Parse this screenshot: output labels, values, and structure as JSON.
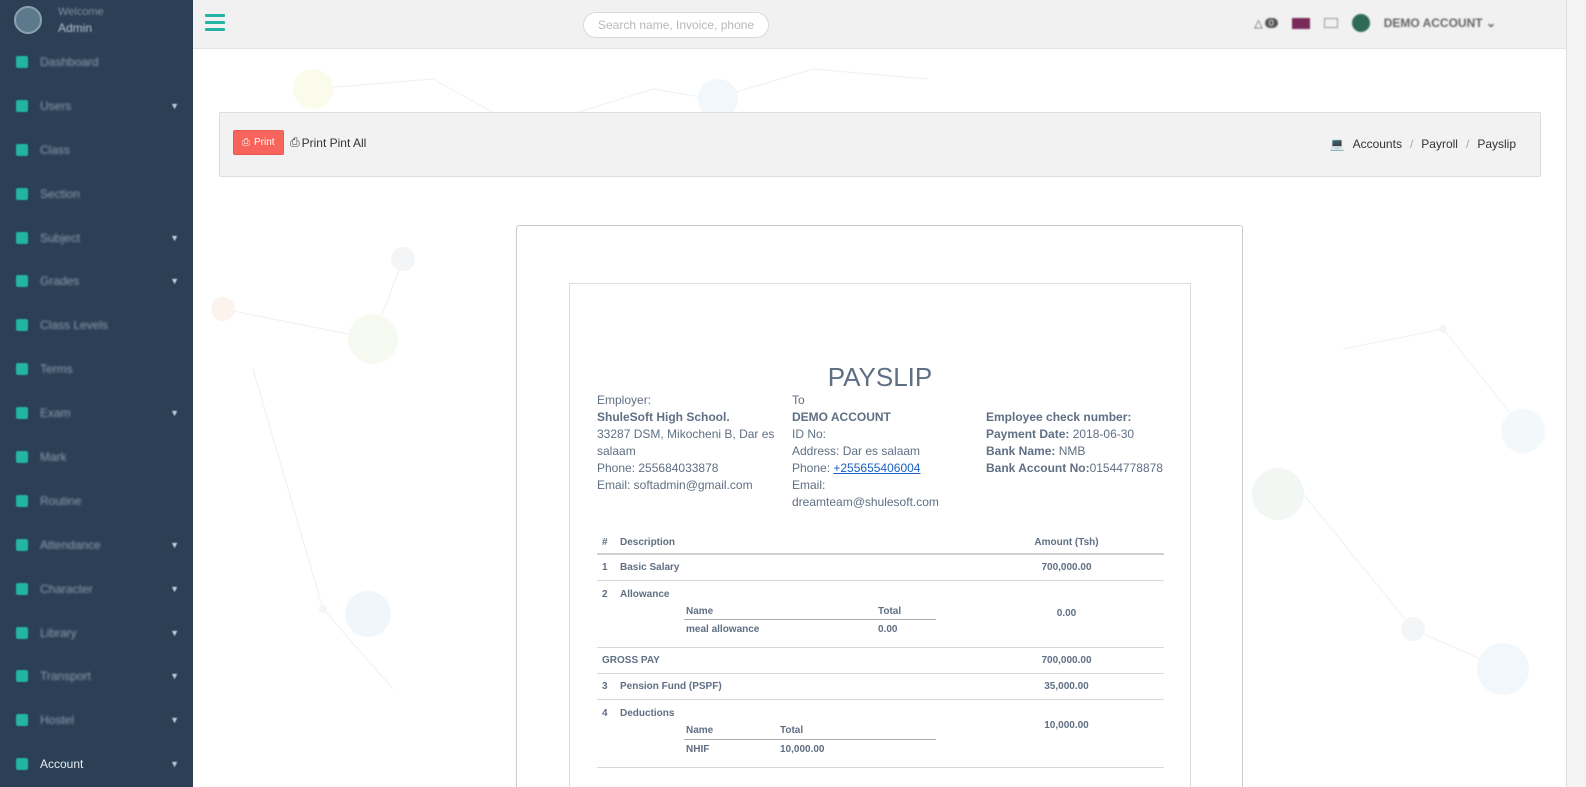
{
  "sidebar": {
    "welcome": "Welcome",
    "user": "Admin",
    "items": [
      {
        "label": "Dashboard",
        "icon": "home-icon",
        "chevron": false
      },
      {
        "label": "Users",
        "icon": "users-icon",
        "chevron": true
      },
      {
        "label": "Class",
        "icon": "sitemap-icon",
        "chevron": false
      },
      {
        "label": "Section",
        "icon": "star-icon",
        "chevron": false
      },
      {
        "label": "Subject",
        "icon": "edit-icon",
        "chevron": true
      },
      {
        "label": "Grades",
        "icon": "edit-icon",
        "chevron": true
      },
      {
        "label": "Class Levels",
        "icon": "bookmark-icon",
        "chevron": false
      },
      {
        "label": "Terms",
        "icon": "signal-icon",
        "chevron": false
      },
      {
        "label": "Exam",
        "icon": "list-icon",
        "chevron": true
      },
      {
        "label": "Mark",
        "icon": "flask-icon",
        "chevron": false
      },
      {
        "label": "Routine",
        "icon": "clock-icon",
        "chevron": false
      },
      {
        "label": "Attendance",
        "icon": "calendar-icon",
        "chevron": true
      },
      {
        "label": "Character",
        "icon": "edit-icon",
        "chevron": true
      },
      {
        "label": "Library",
        "icon": "book-icon",
        "chevron": true
      },
      {
        "label": "Transport",
        "icon": "bus-icon",
        "chevron": true
      },
      {
        "label": "Hostel",
        "icon": "bed-icon",
        "chevron": true
      },
      {
        "label": "Account",
        "icon": "wallet-icon",
        "chevron": true,
        "active": true
      }
    ]
  },
  "topbar": {
    "search_placeholder": "Search name, Invoice, phone, ref",
    "notification_count": "0",
    "account_label": "DEMO ACCOUNT"
  },
  "toolbar": {
    "print_label": "Print",
    "print_all_label": "Print Pint All",
    "breadcrumb": [
      "Accounts",
      "Payroll",
      "Payslip"
    ]
  },
  "payslip": {
    "title": "PAYSLIP",
    "employer": {
      "heading": "Employer:",
      "name": "ShuleSoft High School.",
      "address": "33287 DSM, Mikocheni B, Dar es salaam",
      "phone": "Phone: 255684033878",
      "email": "Email: softadmin@gmail.com"
    },
    "to": {
      "heading": "To",
      "name": "DEMO ACCOUNT",
      "id": "ID No:",
      "address": "Address: Dar es salaam",
      "phone_label": "Phone: ",
      "phone": "+255655406004",
      "email_label": "Email:",
      "email": "dreamteam@shulesoft.com"
    },
    "details": {
      "check_label": "Employee check number:",
      "date_label": "Payment Date:",
      "date": " 2018-06-30",
      "bank_label": "Bank Name:",
      "bank": " NMB",
      "account_label": "Bank Account No:",
      "account": "01544778878"
    },
    "table": {
      "headers": [
        "#",
        "Description",
        "Amount (Tsh)"
      ],
      "row1": {
        "num": "1",
        "desc": "Basic Salary",
        "amount": "700,000.00"
      },
      "row2": {
        "num": "2",
        "desc": "Allowance",
        "amount": "0.00",
        "inner_headers": [
          "Name",
          "Total"
        ],
        "inner_name": "meal allowance",
        "inner_total": "0.00"
      },
      "gross": {
        "label": "GROSS PAY",
        "amount": "700,000.00"
      },
      "row3": {
        "num": "3",
        "desc": "Pension Fund (PSPF)",
        "amount": "35,000.00"
      },
      "row4": {
        "num": "4",
        "desc": "Deductions",
        "amount": "10,000.00",
        "inner_headers": [
          "Name",
          "Total"
        ],
        "inner_name": "NHIF",
        "inner_total": "10,000.00"
      }
    }
  },
  "colors": {
    "sidebar_bg": "#2b3f55",
    "accent": "#22b3a4",
    "print_button": "#f7645b",
    "text": "#5f6f84"
  }
}
